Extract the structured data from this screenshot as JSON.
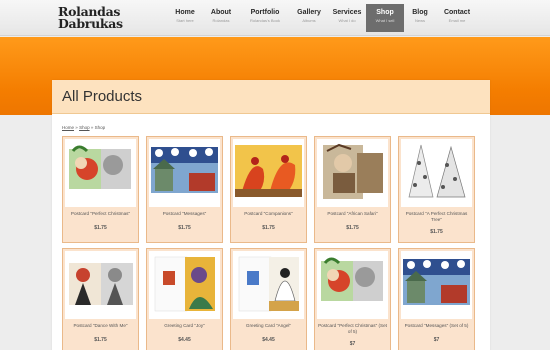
{
  "logo": {
    "line1": "Rolandas",
    "line2": "Dabrukas"
  },
  "nav": [
    {
      "label": "Home",
      "sub": "Start here"
    },
    {
      "label": "About",
      "sub": "Rolandas"
    },
    {
      "label": "Portfolio",
      "sub": "Rolandas's Book"
    },
    {
      "label": "Gallery",
      "sub": "Albums"
    },
    {
      "label": "Services",
      "sub": "What I do"
    },
    {
      "label": "Shop",
      "sub": "What I sell"
    },
    {
      "label": "Blog",
      "sub": "News"
    },
    {
      "label": "Contact",
      "sub": "Email me"
    }
  ],
  "page": {
    "title": "All Products",
    "breadcrumb": {
      "home": "Home",
      "sep": "»",
      "shop": "Shop",
      "current": "Shop"
    }
  },
  "products": [
    {
      "name": "Postcard \"Perfect Christmas\"",
      "price": "$1.75"
    },
    {
      "name": "Postcard \"Messages\"",
      "price": "$1.75"
    },
    {
      "name": "Postcard \"Companions\"",
      "price": "$1.75"
    },
    {
      "name": "Postcard \"African Safari\"",
      "price": "$1.75"
    },
    {
      "name": "Postcard \"A Perfect Christmas Tree\"",
      "price": "$1.75"
    },
    {
      "name": "Postcard \"Dance With Me\"",
      "price": "$1.75"
    },
    {
      "name": "Greeting Card \"Joy\"",
      "price": "$4.45"
    },
    {
      "name": "Greeting Card \"Angel\"",
      "price": "$4.45"
    },
    {
      "name": "Postcard \"Perfect Christmas\" (Set of 5)",
      "price": "$7"
    },
    {
      "name": "Postcard \"Messages\" (Set of 5)",
      "price": "$7"
    }
  ],
  "colors": {
    "accent": "#f47d00",
    "title_bar": "#fde2bf",
    "card_bg": "#fbe3cd",
    "card_border": "#eab98a",
    "active_nav": "#6d6d6d"
  }
}
